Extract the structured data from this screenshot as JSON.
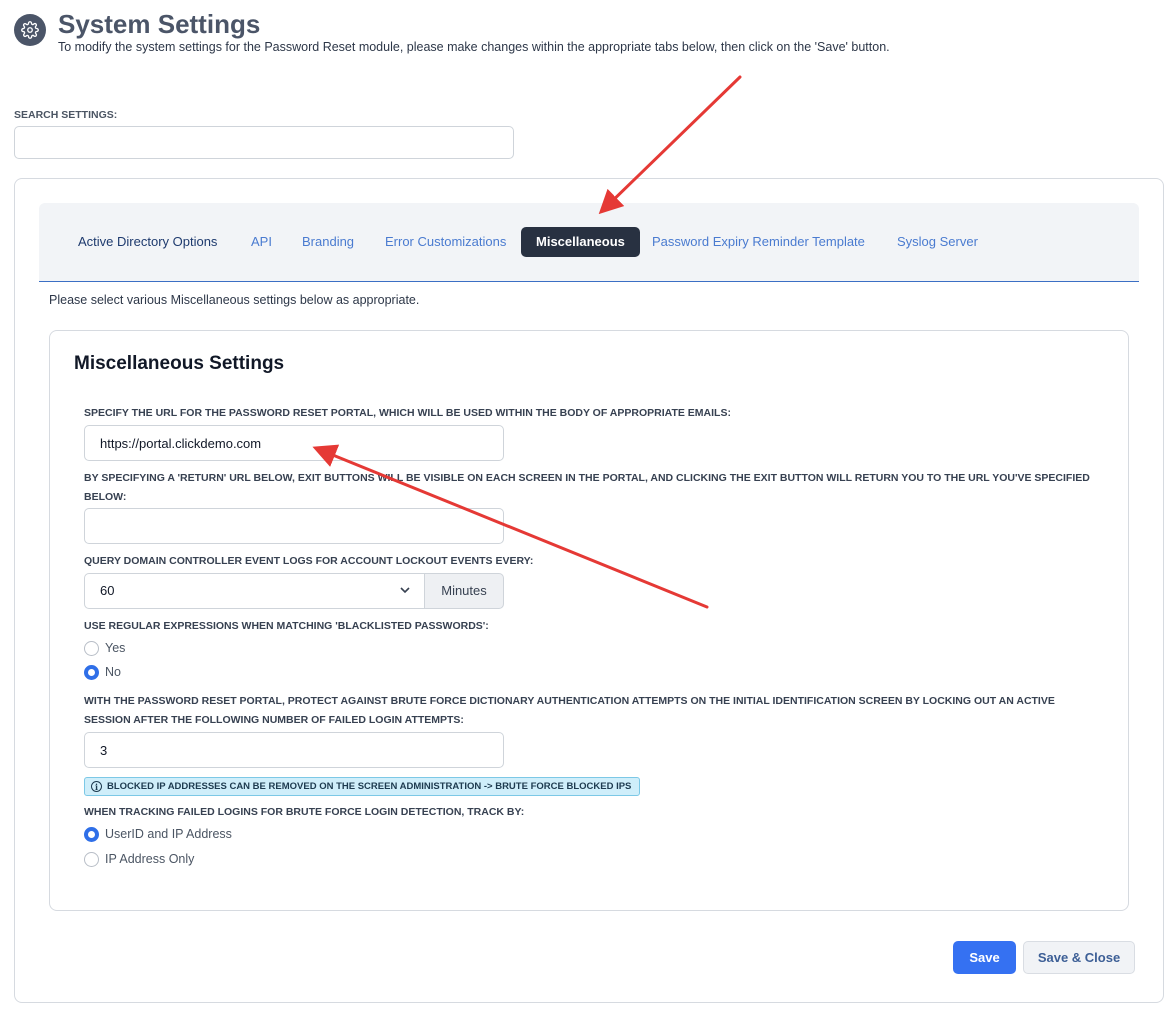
{
  "header": {
    "title": "System Settings",
    "subtitle": "To modify the system settings for the Password Reset module, please make changes within the appropriate tabs below, then click on the 'Save' button.",
    "icon": "gear-icon"
  },
  "search": {
    "label": "SEARCH SETTINGS:",
    "value": "",
    "placeholder": ""
  },
  "tabs": [
    {
      "label": "Active Directory Options"
    },
    {
      "label": "API"
    },
    {
      "label": "Branding"
    },
    {
      "label": "Error Customizations"
    },
    {
      "label": "Miscellaneous",
      "active": true
    },
    {
      "label": "Password Expiry Reminder Template"
    },
    {
      "label": "Syslog Server"
    }
  ],
  "intro": "Please select various Miscellaneous settings below as appropriate.",
  "misc": {
    "title": "Miscellaneous Settings",
    "portal_url_label": "SPECIFY THE URL FOR THE PASSWORD RESET PORTAL, WHICH WILL BE USED WITHIN THE BODY OF APPROPRIATE EMAILS:",
    "portal_url_value": "https://portal.clickdemo.com",
    "return_url_label": "BY SPECIFYING A 'RETURN' URL BELOW, EXIT BUTTONS WILL BE VISIBLE ON EACH SCREEN IN THE PORTAL, AND CLICKING THE EXIT BUTTON WILL RETURN YOU TO THE URL YOU'VE SPECIFIED BELOW:",
    "return_url_value": "",
    "query_label": "QUERY DOMAIN CONTROLLER EVENT LOGS FOR ACCOUNT LOCKOUT EVENTS EVERY:",
    "query_value": "60",
    "query_unit": "Minutes",
    "regex_label": "USE REGULAR EXPRESSIONS WHEN MATCHING 'BLACKLISTED PASSWORDS':",
    "regex_options": [
      {
        "label": "Yes",
        "checked": false
      },
      {
        "label": "No",
        "checked": true
      }
    ],
    "brute_label": "WITH THE PASSWORD RESET PORTAL, PROTECT AGAINST BRUTE FORCE DICTIONARY AUTHENTICATION ATTEMPTS ON THE INITIAL IDENTIFICATION SCREEN BY LOCKING OUT AN ACTIVE SESSION AFTER THE FOLLOWING NUMBER OF FAILED LOGIN ATTEMPTS:",
    "brute_value": "3",
    "info_badge": "BLOCKED IP ADDRESSES CAN BE REMOVED ON THE SCREEN ADMINISTRATION -> BRUTE FORCE BLOCKED IPS",
    "track_label": "WHEN TRACKING FAILED LOGINS FOR BRUTE FORCE LOGIN DETECTION, TRACK BY:",
    "track_options": [
      {
        "label": "UserID and IP Address",
        "checked": true
      },
      {
        "label": "IP Address Only",
        "checked": false
      }
    ]
  },
  "buttons": {
    "save": "Save",
    "save_close": "Save & Close"
  },
  "colors": {
    "primary": "#3571f2",
    "active_tab": "#283141",
    "tab_link": "#4a7bd0",
    "annotation_arrow": "#e53935",
    "info_badge_bg": "#cfeefa"
  }
}
